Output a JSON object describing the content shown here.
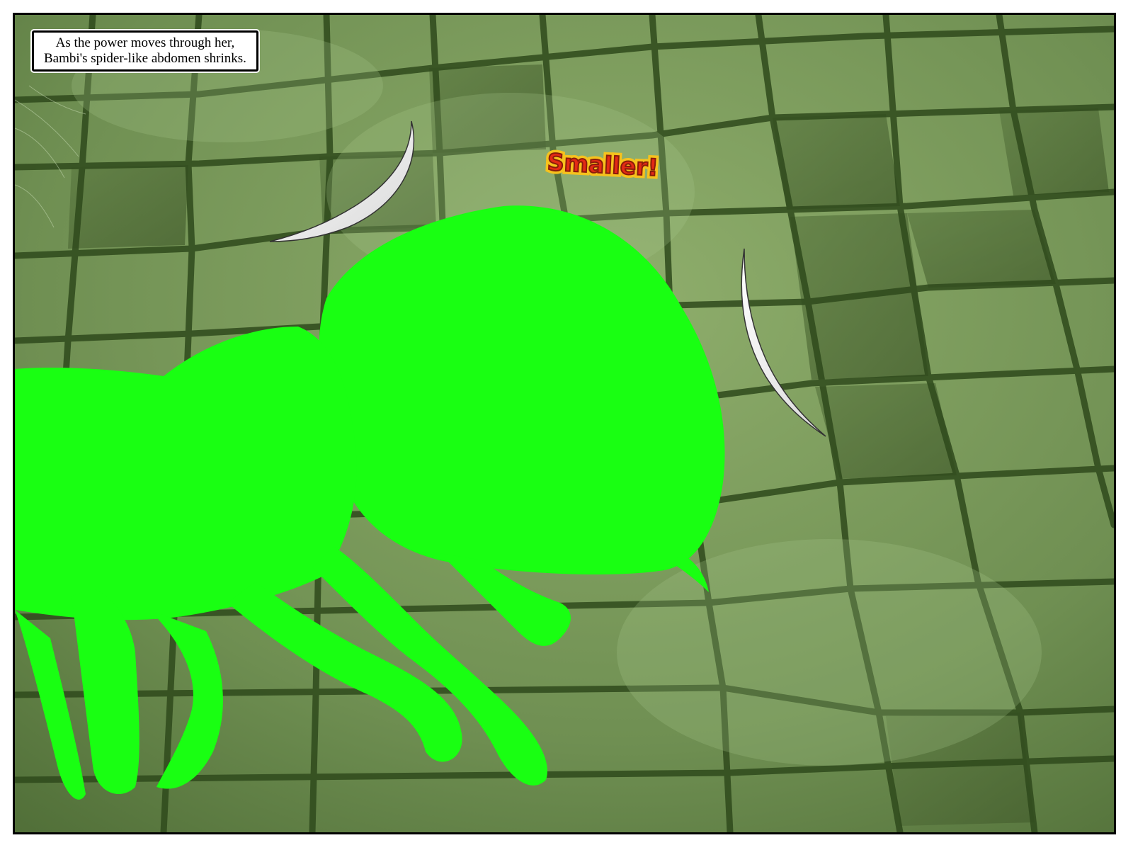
{
  "caption": {
    "line1": "As the power moves through her,",
    "line2": "Bambi's spider-like abdomen shrinks."
  },
  "sound_effect": {
    "text": "Smaller!",
    "fill_color": "#e42a15",
    "outline_color": "#f6c21d"
  },
  "scene": {
    "floor_color": "#6f8f52",
    "grout_color": "#2f4a1c",
    "glow_color": "#19ff12"
  }
}
